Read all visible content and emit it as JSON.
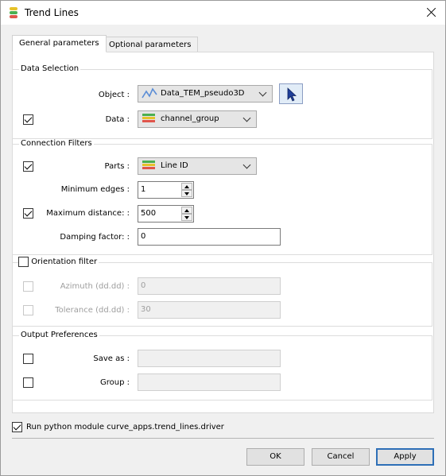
{
  "window": {
    "title": "Trend Lines"
  },
  "tabs": [
    {
      "label": "General parameters"
    },
    {
      "label": "Optional parameters"
    }
  ],
  "data_selection": {
    "title": "Data Selection",
    "object_label": "Object :",
    "object_value": "Data_TEM_pseudo3D",
    "data_label": "Data :",
    "data_value": "channel_group",
    "data_checked": true
  },
  "connection_filters": {
    "title": "Connection Filters",
    "parts_label": "Parts :",
    "parts_value": "Line ID",
    "parts_checked": true,
    "min_edges_label": "Minimum edges :",
    "min_edges_value": "1",
    "max_distance_label": "Maximum distance: :",
    "max_distance_value": "500",
    "max_distance_checked": true,
    "damping_label": "Damping factor: :",
    "damping_value": "0"
  },
  "orientation_filter": {
    "title": "Orientation filter",
    "checked": false,
    "azimuth_label": "Azimuth (dd.dd) :",
    "azimuth_value": "0",
    "tolerance_label": "Tolerance (dd.dd) :",
    "tolerance_value": "30"
  },
  "output_preferences": {
    "title": "Output Preferences",
    "save_as_label": "Save as :",
    "save_as_value": "",
    "group_label": "Group :",
    "group_value": ""
  },
  "run_python": {
    "label": "Run python module curve_apps.trend_lines.driver",
    "checked": true
  },
  "buttons": {
    "ok": "OK",
    "cancel": "Cancel",
    "apply": "Apply"
  },
  "colors": {
    "layer_green": "#4caf50",
    "layer_yellow": "#e6c229",
    "layer_red": "#e0554a",
    "layer_blue": "#5b8dd6",
    "accent_border": "#2e6fb7"
  }
}
